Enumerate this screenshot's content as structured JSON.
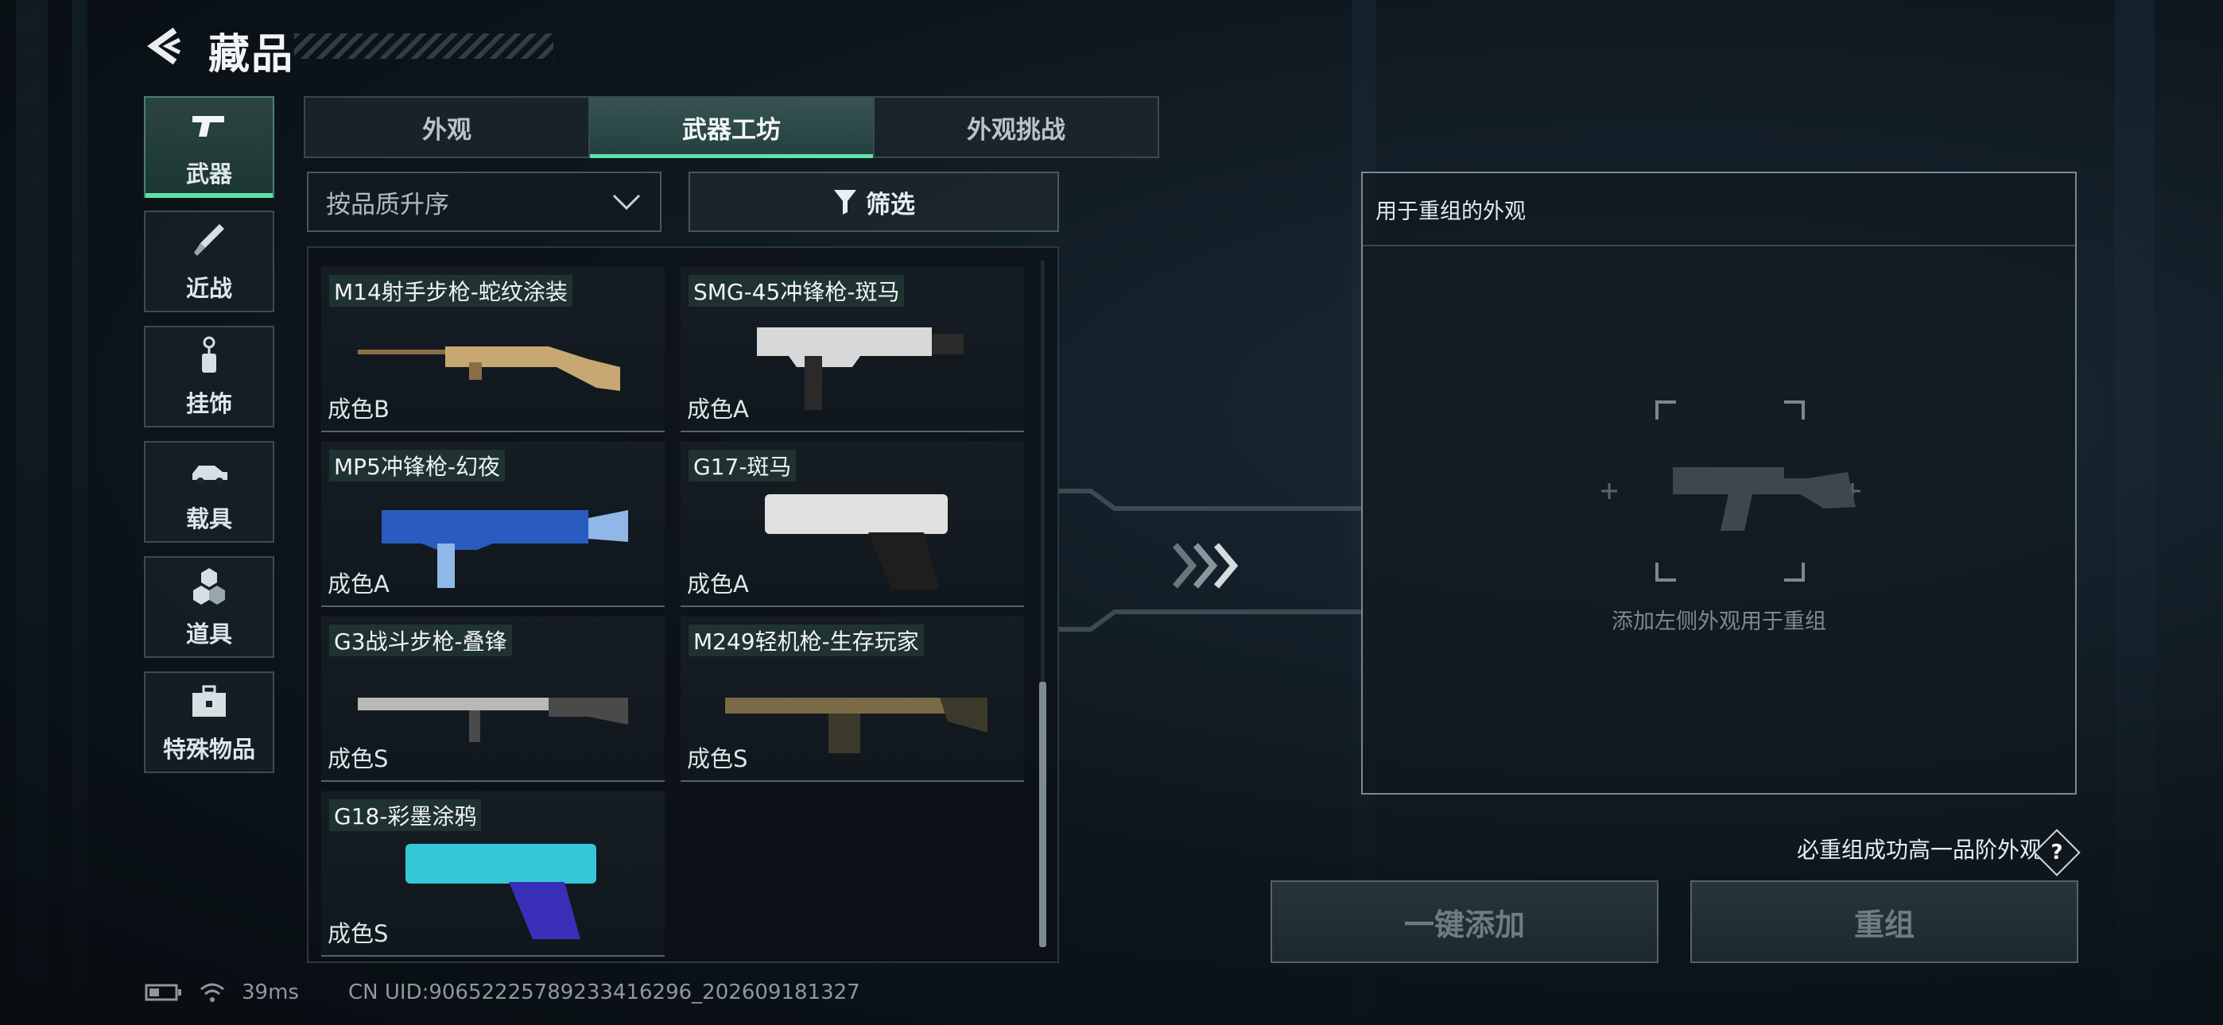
{
  "header": {
    "title": "藏品"
  },
  "categories": [
    {
      "label": "武器",
      "icon": "pistol-icon",
      "active": true
    },
    {
      "label": "近战",
      "icon": "knife-icon",
      "active": false
    },
    {
      "label": "挂饰",
      "icon": "charm-icon",
      "active": false
    },
    {
      "label": "载具",
      "icon": "vehicle-icon",
      "active": false
    },
    {
      "label": "道具",
      "icon": "items-icon",
      "active": false
    },
    {
      "label": "特殊物品",
      "icon": "toolbox-icon",
      "active": false
    }
  ],
  "tabs": [
    {
      "label": "外观",
      "active": false
    },
    {
      "label": "武器工坊",
      "active": true
    },
    {
      "label": "外观挑战",
      "active": false
    }
  ],
  "sort": {
    "value": "按品质升序"
  },
  "filter": {
    "label": "筛选"
  },
  "skins": [
    {
      "name": "M14射手步枪-蛇纹涂装",
      "grade": "成色B",
      "colors": [
        "#8a6f45",
        "#c7a872"
      ]
    },
    {
      "name": "SMG-45冲锋枪-斑马",
      "grade": "成色A",
      "colors": [
        "#d8d8d8",
        "#2a2a2a"
      ]
    },
    {
      "name": "MP5冲锋枪-幻夜",
      "grade": "成色A",
      "colors": [
        "#2a5bbf",
        "#8fb7e8"
      ]
    },
    {
      "name": "G17-斑马",
      "grade": "成色A",
      "colors": [
        "#e0e0e0",
        "#1e1e1e"
      ]
    },
    {
      "name": "G3战斗步枪-叠锋",
      "grade": "成色S",
      "colors": [
        "#b8b8b8",
        "#4a4a4a"
      ]
    },
    {
      "name": "M249轻机枪-生存玩家",
      "grade": "成色S",
      "colors": [
        "#7a6a45",
        "#3b3a2a"
      ]
    },
    {
      "name": "G18-彩墨涂鸦",
      "grade": "成色S",
      "colors": [
        "#35c7d6",
        "#3a2fb8"
      ]
    }
  ],
  "panel": {
    "title": "用于重组的外观",
    "hint": "添加左侧外观用于重组"
  },
  "note": {
    "text": "必重组成功高一品阶外观",
    "help": "?"
  },
  "buttons": {
    "add": "一键添加",
    "recombine": "重组"
  },
  "status": {
    "ping": "39ms",
    "uid": "CN UID:9065222578923341629​6_202609181327"
  },
  "colors": {
    "accent": "#5ee3a8"
  }
}
